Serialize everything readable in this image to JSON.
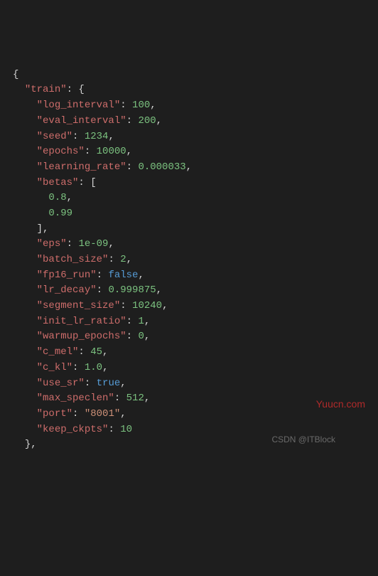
{
  "lines": [
    {
      "indent": "",
      "tokens": [
        {
          "t": "{",
          "c": "p"
        }
      ]
    },
    {
      "indent": "  ",
      "tokens": [
        {
          "t": "\"train\"",
          "c": "k"
        },
        {
          "t": ": {",
          "c": "p"
        }
      ]
    },
    {
      "indent": "    ",
      "tokens": [
        {
          "t": "\"log_interval\"",
          "c": "k"
        },
        {
          "t": ": ",
          "c": "p"
        },
        {
          "t": "100",
          "c": "n"
        },
        {
          "t": ",",
          "c": "p"
        }
      ]
    },
    {
      "indent": "    ",
      "tokens": [
        {
          "t": "\"eval_interval\"",
          "c": "k"
        },
        {
          "t": ": ",
          "c": "p"
        },
        {
          "t": "200",
          "c": "n"
        },
        {
          "t": ",",
          "c": "p"
        }
      ]
    },
    {
      "indent": "    ",
      "tokens": [
        {
          "t": "\"seed\"",
          "c": "k"
        },
        {
          "t": ": ",
          "c": "p"
        },
        {
          "t": "1234",
          "c": "n"
        },
        {
          "t": ",",
          "c": "p"
        }
      ]
    },
    {
      "indent": "    ",
      "tokens": [
        {
          "t": "\"epochs\"",
          "c": "k"
        },
        {
          "t": ": ",
          "c": "p"
        },
        {
          "t": "10000",
          "c": "n"
        },
        {
          "t": ",",
          "c": "p"
        }
      ]
    },
    {
      "indent": "    ",
      "tokens": [
        {
          "t": "\"learning_rate\"",
          "c": "k"
        },
        {
          "t": ": ",
          "c": "p"
        },
        {
          "t": "0.000033",
          "c": "n"
        },
        {
          "t": ",",
          "c": "p"
        }
      ]
    },
    {
      "indent": "    ",
      "tokens": [
        {
          "t": "\"betas\"",
          "c": "k"
        },
        {
          "t": ": [",
          "c": "p"
        }
      ]
    },
    {
      "indent": "      ",
      "tokens": [
        {
          "t": "0.8",
          "c": "n"
        },
        {
          "t": ",",
          "c": "p"
        }
      ]
    },
    {
      "indent": "      ",
      "tokens": [
        {
          "t": "0.99",
          "c": "n"
        }
      ]
    },
    {
      "indent": "    ",
      "tokens": [
        {
          "t": "],",
          "c": "p"
        }
      ]
    },
    {
      "indent": "    ",
      "tokens": [
        {
          "t": "\"eps\"",
          "c": "k"
        },
        {
          "t": ": ",
          "c": "p"
        },
        {
          "t": "1e-09",
          "c": "n"
        },
        {
          "t": ",",
          "c": "p"
        }
      ]
    },
    {
      "indent": "    ",
      "tokens": [
        {
          "t": "\"batch_size\"",
          "c": "k"
        },
        {
          "t": ": ",
          "c": "p"
        },
        {
          "t": "2",
          "c": "n"
        },
        {
          "t": ",",
          "c": "p"
        }
      ]
    },
    {
      "indent": "    ",
      "tokens": [
        {
          "t": "\"fp16_run\"",
          "c": "k"
        },
        {
          "t": ": ",
          "c": "p"
        },
        {
          "t": "false",
          "c": "b"
        },
        {
          "t": ",",
          "c": "p"
        }
      ]
    },
    {
      "indent": "    ",
      "tokens": [
        {
          "t": "\"lr_decay\"",
          "c": "k"
        },
        {
          "t": ": ",
          "c": "p"
        },
        {
          "t": "0.999875",
          "c": "n"
        },
        {
          "t": ",",
          "c": "p"
        }
      ]
    },
    {
      "indent": "    ",
      "tokens": [
        {
          "t": "\"segment_size\"",
          "c": "k"
        },
        {
          "t": ": ",
          "c": "p"
        },
        {
          "t": "10240",
          "c": "n"
        },
        {
          "t": ",",
          "c": "p"
        }
      ]
    },
    {
      "indent": "    ",
      "tokens": [
        {
          "t": "\"init_lr_ratio\"",
          "c": "k"
        },
        {
          "t": ": ",
          "c": "p"
        },
        {
          "t": "1",
          "c": "n"
        },
        {
          "t": ",",
          "c": "p"
        }
      ]
    },
    {
      "indent": "    ",
      "tokens": [
        {
          "t": "\"warmup_epochs\"",
          "c": "k"
        },
        {
          "t": ": ",
          "c": "p"
        },
        {
          "t": "0",
          "c": "n"
        },
        {
          "t": ",",
          "c": "p"
        }
      ]
    },
    {
      "indent": "    ",
      "tokens": [
        {
          "t": "\"c_mel\"",
          "c": "k"
        },
        {
          "t": ": ",
          "c": "p"
        },
        {
          "t": "45",
          "c": "n"
        },
        {
          "t": ",",
          "c": "p"
        }
      ]
    },
    {
      "indent": "    ",
      "tokens": [
        {
          "t": "\"c_kl\"",
          "c": "k"
        },
        {
          "t": ": ",
          "c": "p"
        },
        {
          "t": "1.0",
          "c": "n"
        },
        {
          "t": ",",
          "c": "p"
        }
      ]
    },
    {
      "indent": "    ",
      "tokens": [
        {
          "t": "\"use_sr\"",
          "c": "k"
        },
        {
          "t": ": ",
          "c": "p"
        },
        {
          "t": "true",
          "c": "b"
        },
        {
          "t": ",",
          "c": "p"
        }
      ]
    },
    {
      "indent": "    ",
      "tokens": [
        {
          "t": "\"max_speclen\"",
          "c": "k"
        },
        {
          "t": ": ",
          "c": "p"
        },
        {
          "t": "512",
          "c": "n"
        },
        {
          "t": ",",
          "c": "p"
        }
      ]
    },
    {
      "indent": "    ",
      "tokens": [
        {
          "t": "\"port\"",
          "c": "k"
        },
        {
          "t": ": ",
          "c": "p"
        },
        {
          "t": "\"8001\"",
          "c": "s"
        },
        {
          "t": ",",
          "c": "p"
        }
      ]
    },
    {
      "indent": "    ",
      "tokens": [
        {
          "t": "\"keep_ckpts\"",
          "c": "k"
        },
        {
          "t": ": ",
          "c": "p"
        },
        {
          "t": "10",
          "c": "n"
        }
      ]
    },
    {
      "indent": "  ",
      "tokens": [
        {
          "t": "},",
          "c": "p"
        }
      ]
    }
  ],
  "watermarks": {
    "right": "Yuucn.com",
    "bottom": "CSDN @ITBlock"
  }
}
